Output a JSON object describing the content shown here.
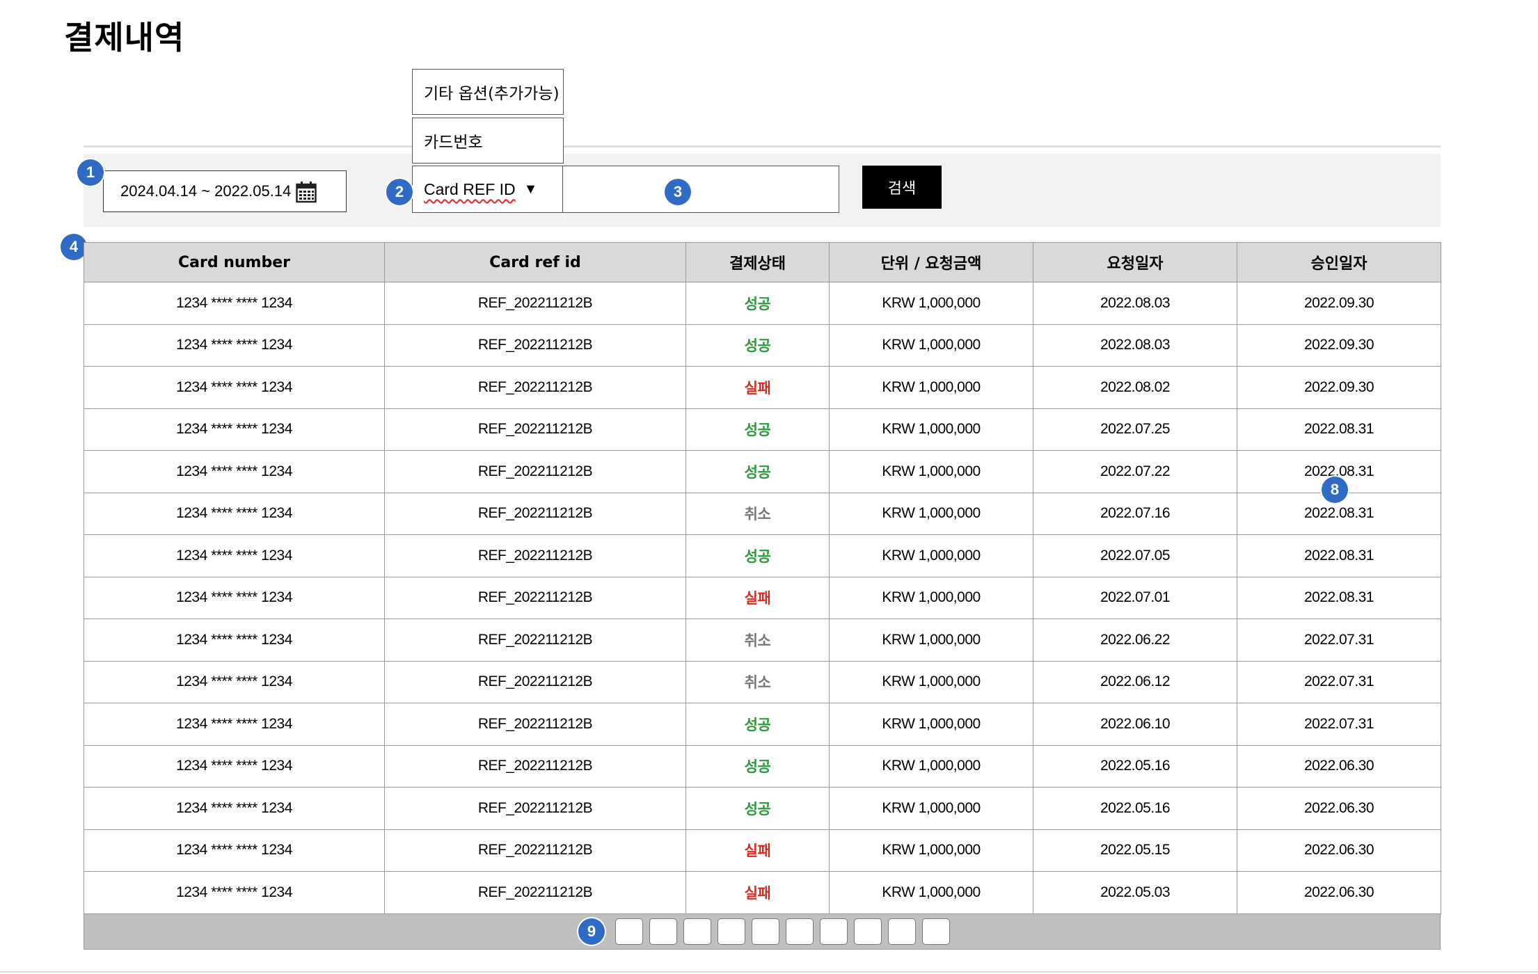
{
  "page": {
    "title": "결제내역"
  },
  "filters": {
    "date_range": "2024.04.14 ~ 2022.05.14",
    "dropdown_options": [
      "기타 옵션(추가가능)",
      "카드번호"
    ],
    "selected_type": "Card REF ID",
    "search_value": "",
    "search_label": "검색"
  },
  "markers": [
    "1",
    "2",
    "3",
    "4",
    "8",
    "9"
  ],
  "table": {
    "headers": [
      "Card number",
      "Card ref id",
      "결제상태",
      "단위 / 요청금액",
      "요청일자",
      "승인일자"
    ],
    "rows": [
      {
        "card": "1234 **** **** 1234",
        "ref": "REF_202211212B",
        "status": "성공",
        "status_type": "success",
        "amount": "KRW 1,000,000",
        "requested": "2022.08.03",
        "approved": "2022.09.30"
      },
      {
        "card": "1234 **** **** 1234",
        "ref": "REF_202211212B",
        "status": "성공",
        "status_type": "success",
        "amount": "KRW 1,000,000",
        "requested": "2022.08.03",
        "approved": "2022.09.30"
      },
      {
        "card": "1234 **** **** 1234",
        "ref": "REF_202211212B",
        "status": "실패",
        "status_type": "fail",
        "amount": "KRW 1,000,000",
        "requested": "2022.08.02",
        "approved": "2022.09.30"
      },
      {
        "card": "1234 **** **** 1234",
        "ref": "REF_202211212B",
        "status": "성공",
        "status_type": "success",
        "amount": "KRW 1,000,000",
        "requested": "2022.07.25",
        "approved": "2022.08.31"
      },
      {
        "card": "1234 **** **** 1234",
        "ref": "REF_202211212B",
        "status": "성공",
        "status_type": "success",
        "amount": "KRW 1,000,000",
        "requested": "2022.07.22",
        "approved": "2022.08.31"
      },
      {
        "card": "1234 **** **** 1234",
        "ref": "REF_202211212B",
        "status": "취소",
        "status_type": "cancel",
        "amount": "KRW 1,000,000",
        "requested": "2022.07.16",
        "approved": "2022.08.31"
      },
      {
        "card": "1234 **** **** 1234",
        "ref": "REF_202211212B",
        "status": "성공",
        "status_type": "success",
        "amount": "KRW 1,000,000",
        "requested": "2022.07.05",
        "approved": "2022.08.31"
      },
      {
        "card": "1234 **** **** 1234",
        "ref": "REF_202211212B",
        "status": "실패",
        "status_type": "fail",
        "amount": "KRW 1,000,000",
        "requested": "2022.07.01",
        "approved": "2022.08.31"
      },
      {
        "card": "1234 **** **** 1234",
        "ref": "REF_202211212B",
        "status": "취소",
        "status_type": "cancel",
        "amount": "KRW 1,000,000",
        "requested": "2022.06.22",
        "approved": "2022.07.31"
      },
      {
        "card": "1234 **** **** 1234",
        "ref": "REF_202211212B",
        "status": "취소",
        "status_type": "cancel",
        "amount": "KRW 1,000,000",
        "requested": "2022.06.12",
        "approved": "2022.07.31"
      },
      {
        "card": "1234 **** **** 1234",
        "ref": "REF_202211212B",
        "status": "성공",
        "status_type": "success",
        "amount": "KRW 1,000,000",
        "requested": "2022.06.10",
        "approved": "2022.07.31"
      },
      {
        "card": "1234 **** **** 1234",
        "ref": "REF_202211212B",
        "status": "성공",
        "status_type": "success",
        "amount": "KRW 1,000,000",
        "requested": "2022.05.16",
        "approved": "2022.06.30"
      },
      {
        "card": "1234 **** **** 1234",
        "ref": "REF_202211212B",
        "status": "성공",
        "status_type": "success",
        "amount": "KRW 1,000,000",
        "requested": "2022.05.16",
        "approved": "2022.06.30"
      },
      {
        "card": "1234 **** **** 1234",
        "ref": "REF_202211212B",
        "status": "실패",
        "status_type": "fail",
        "amount": "KRW 1,000,000",
        "requested": "2022.05.15",
        "approved": "2022.06.30"
      },
      {
        "card": "1234 **** **** 1234",
        "ref": "REF_202211212B",
        "status": "실패",
        "status_type": "fail",
        "amount": "KRW 1,000,000",
        "requested": "2022.05.03",
        "approved": "2022.06.30"
      }
    ]
  },
  "pagination": {
    "page_box_count": 10
  },
  "colors": {
    "success": "#2e9a3e",
    "fail": "#e0251b",
    "cancel": "#777777",
    "marker": "#2f6bc4",
    "search_button": "#000000"
  }
}
